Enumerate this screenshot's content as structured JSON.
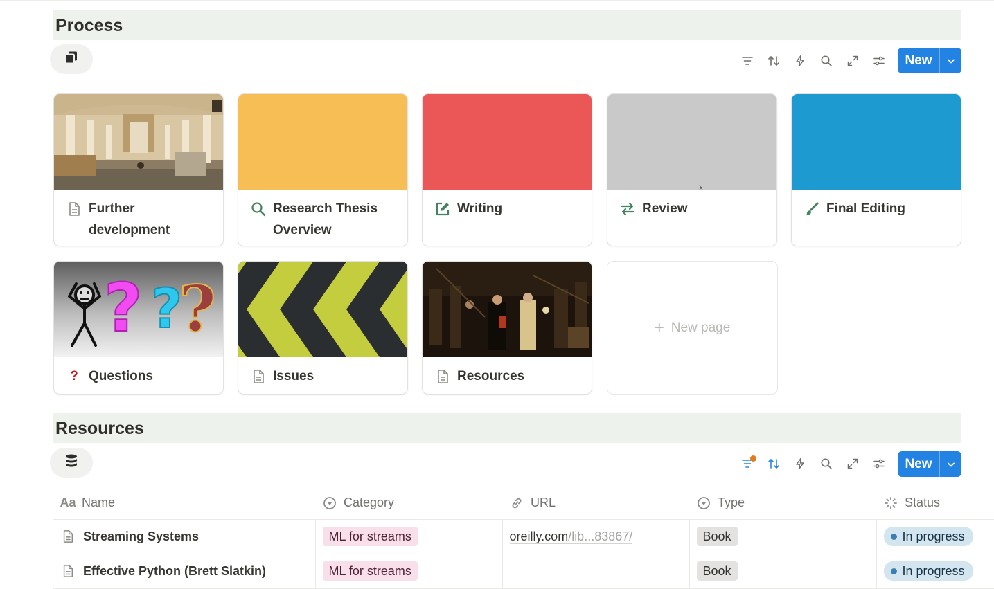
{
  "sections": {
    "process": {
      "title": "Process"
    },
    "resources": {
      "title": "Resources"
    }
  },
  "toolbar": {
    "new_label": "New",
    "icons": [
      "filter-icon",
      "sort-icon",
      "automation-bolt-icon",
      "search-icon",
      "expand-icon",
      "settings-sliders-icon",
      "chevron-down-icon"
    ],
    "filter_active_color": "#e07b1f"
  },
  "cards": [
    {
      "title": "Further development",
      "icon": "page-icon",
      "cover": "cathedral-interior-painting"
    },
    {
      "title": "Research Thesis Overview",
      "icon": "search-icon",
      "cover_color": "#f7be55"
    },
    {
      "title": "Writing",
      "icon": "edit-icon",
      "cover_color": "#eb5757"
    },
    {
      "title": "Review",
      "icon": "arrows-exchange-icon",
      "cover_color": "#c9c9c9"
    },
    {
      "title": "Final Editing",
      "icon": "brush-icon",
      "cover_color": "#1d9bd1"
    },
    {
      "title": "Questions",
      "icon": "question-mark-icon",
      "cover": "question-marks-stick-figure"
    },
    {
      "title": "Issues",
      "icon": "page-icon",
      "cover": "chevron-stripes"
    },
    {
      "title": "Resources",
      "icon": "page-icon",
      "cover": "night-watch-painting"
    }
  ],
  "new_page_label": "New page",
  "table": {
    "columns": [
      {
        "label": "Name",
        "icon": "text-aa-icon"
      },
      {
        "label": "Category",
        "icon": "select-icon"
      },
      {
        "label": "URL",
        "icon": "link-icon"
      },
      {
        "label": "Type",
        "icon": "select-icon"
      },
      {
        "label": "Status",
        "icon": "status-icon"
      }
    ],
    "rows": [
      {
        "name": "Streaming Systems",
        "category": "ML for streams",
        "url_main": "oreilly.com",
        "url_rest": "/lib...83867/",
        "type": "Book",
        "status": "In progress"
      },
      {
        "name": "Effective Python (Brett Slatkin)",
        "category": "ML for streams",
        "url_main": "",
        "url_rest": "",
        "type": "Book",
        "status": "In progress"
      }
    ]
  },
  "colors": {
    "header_bg": "#edf3ec",
    "accent_blue": "#2383e2",
    "icon_green": "#448361",
    "question_red": "#c4161c"
  }
}
